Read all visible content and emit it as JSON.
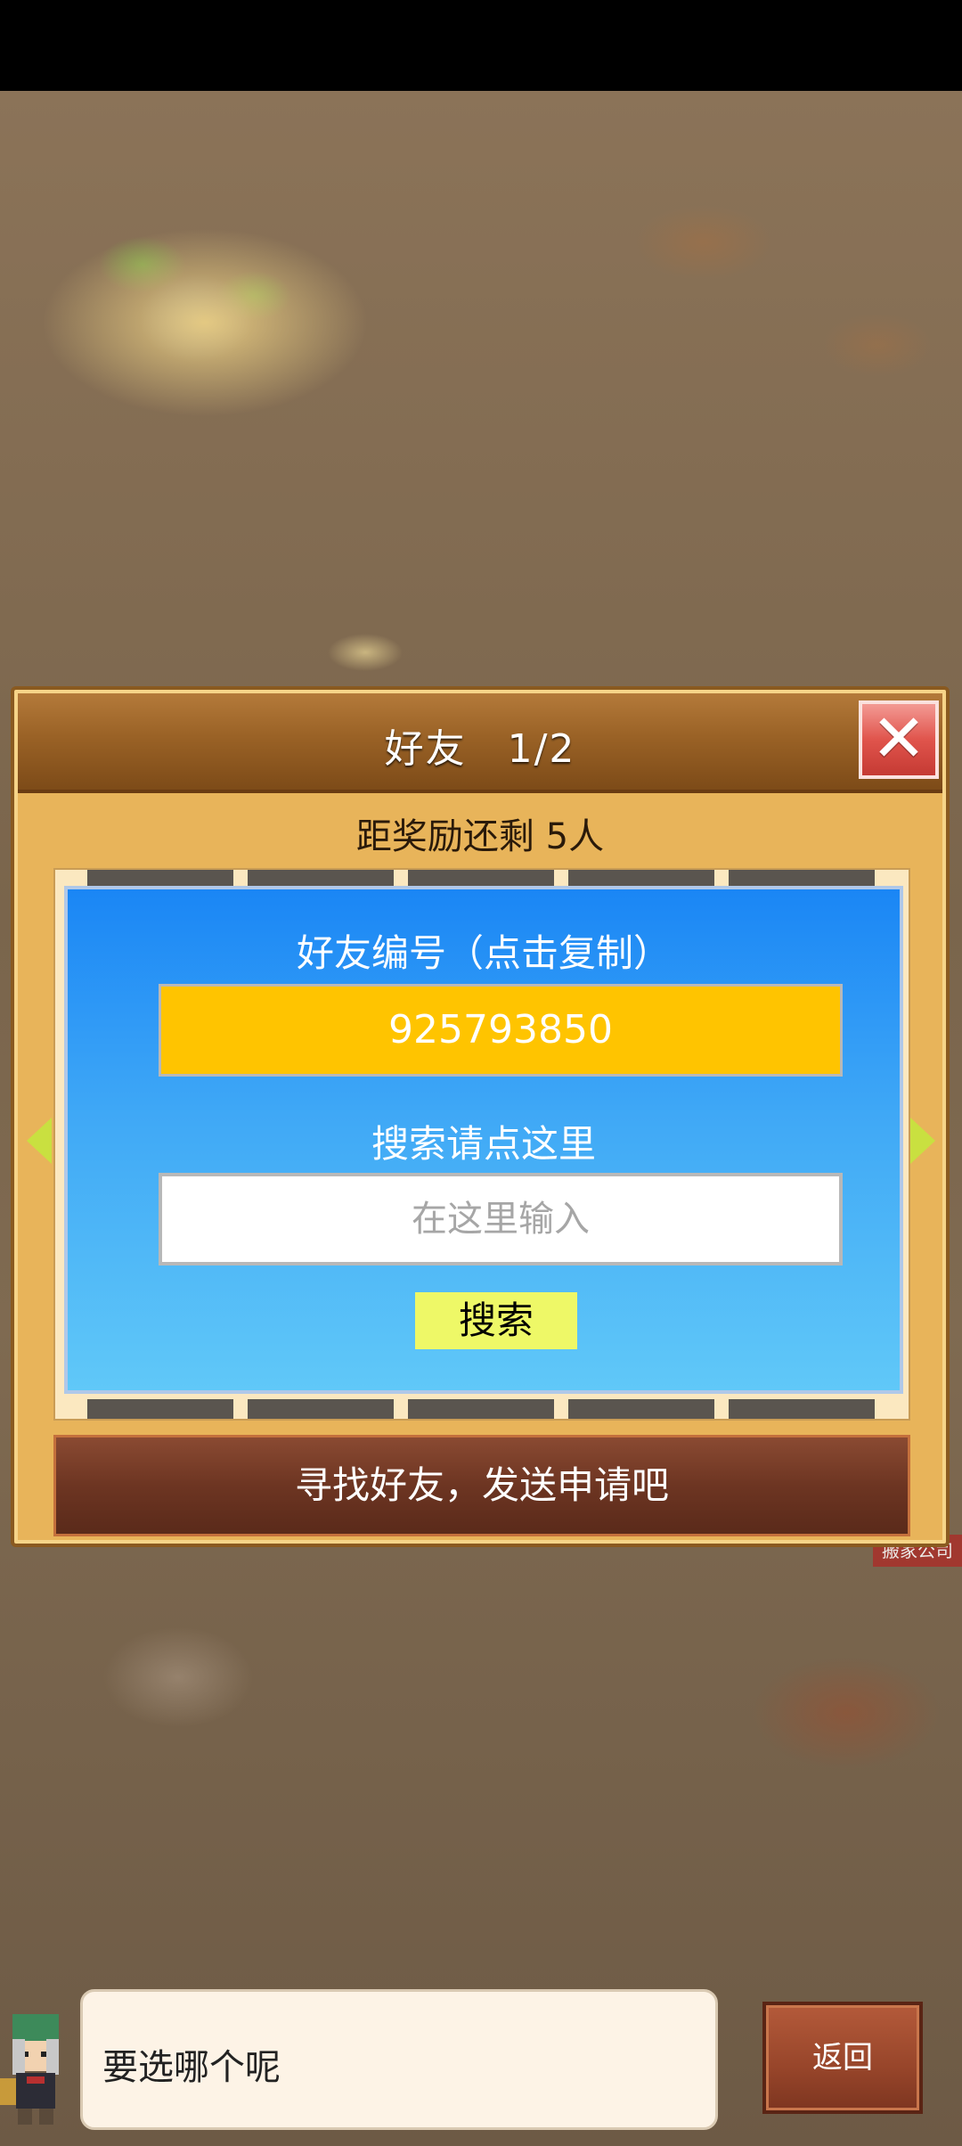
{
  "dialog": {
    "title": "好友　1/2",
    "close_icon": "✕",
    "reward_text": "距奖励还剩 5人",
    "friend_id_label": "好友编号（点击复制）",
    "friend_id": "925793850",
    "search_label": "搜索请点这里",
    "search_placeholder": "在这里输入",
    "search_button": "搜索",
    "find_friend_button": "寻找好友，发送申请吧"
  },
  "background": {
    "sign_text": "搬家公司"
  },
  "bottom": {
    "speech_text": "要选哪个呢",
    "back_button": "返回"
  },
  "colors": {
    "panel_blue": "#1a86f5",
    "id_box": "#ffc400",
    "search_button": "#eef867",
    "close_red": "#e0544c",
    "dialog_gold": "#e8b45a"
  }
}
